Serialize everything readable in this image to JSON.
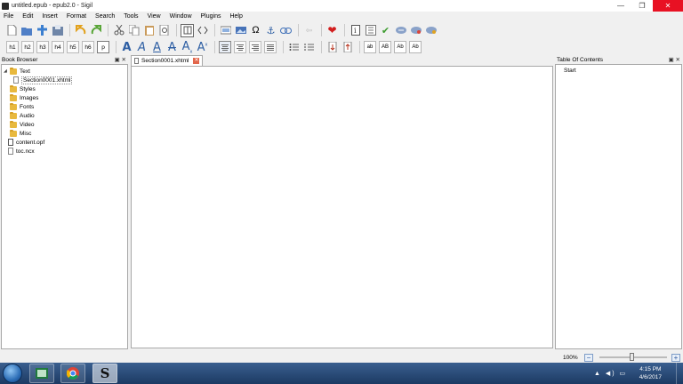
{
  "window": {
    "title": "untitled.epub - epub2.0 - Sigil",
    "minimize_glyph": "—",
    "maximize_glyph": "❐",
    "close_glyph": "✕"
  },
  "menu": [
    "File",
    "Edit",
    "Insert",
    "Format",
    "Search",
    "Tools",
    "View",
    "Window",
    "Plugins",
    "Help"
  ],
  "heading_buttons": [
    "h1",
    "h2",
    "h3",
    "h4",
    "h5",
    "h6",
    "p"
  ],
  "case_buttons": [
    "ab",
    "AB",
    "Ab",
    "Ab"
  ],
  "book_browser": {
    "title": "Book Browser",
    "items": {
      "text": "Text",
      "section": "Section0001.xhtml",
      "styles": "Styles",
      "images": "Images",
      "fonts": "Fonts",
      "audio": "Audio",
      "video": "Video",
      "misc": "Misc",
      "opf": "content.opf",
      "ncx": "toc.ncx"
    }
  },
  "editor": {
    "tab_label": "Section0001.xhtml"
  },
  "toc": {
    "title": "Table Of Contents",
    "entry": "Start"
  },
  "status": {
    "zoom": "100%"
  },
  "taskbar": {
    "time": "4:15 PM",
    "date": "4/6/2017",
    "sigil_glyph": "S"
  },
  "colors": {
    "accent": "#2d5ea3",
    "close_red": "#e81123",
    "folder": "#e8b93e",
    "taskbar": "#1c3a63"
  }
}
